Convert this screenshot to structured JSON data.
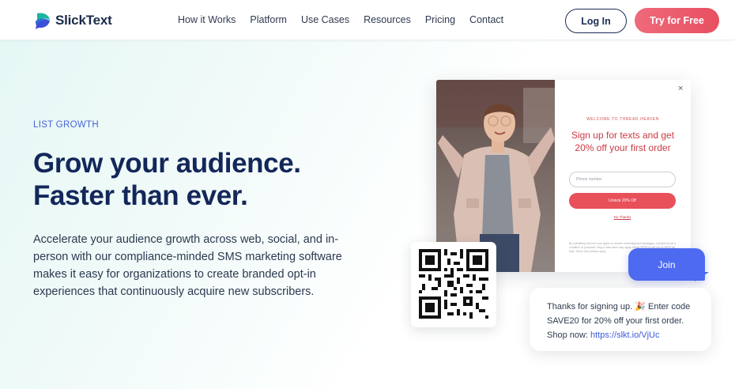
{
  "brand": {
    "name": "SlickText",
    "colors": {
      "navy": "#13275a",
      "accent_blue": "#4a62d8",
      "cta_red": "#e8505f",
      "teal": "#1bb5a0"
    }
  },
  "nav": {
    "items": [
      "How it Works",
      "Platform",
      "Use Cases",
      "Resources",
      "Pricing",
      "Contact"
    ],
    "login_label": "Log In",
    "cta_label": "Try for Free"
  },
  "hero": {
    "eyebrow": "LIST GROWTH",
    "headline_line1": "Grow your audience.",
    "headline_line2": "Faster than ever.",
    "body": "Accelerate your audience growth across web, social, and in-person with our compliance-minded SMS marketing software makes it easy for organizations to create branded opt-in experiences that continuously acquire new subscribers."
  },
  "popup": {
    "close_icon": "×",
    "eyebrow": "WELCOME TO THREAD HEAVEN",
    "title": "Sign up for texts and get 20% off your first order",
    "input_placeholder": "Phone number",
    "button_label": "Unlock 20% Off",
    "decline_label": "No Thanks",
    "fine_print": "By submitting this form you agree to receive marketing text messages. Consent is not a condition of purchase. Msg & data rates may apply. Reply STOP to opt out or HELP for help. Terms and privacy apply."
  },
  "join_bubble": {
    "label": "Join"
  },
  "confirmation_message": {
    "line1": "Thanks for signing up. 🎉 Enter code",
    "line2": "SAVE20 for 20% off your first order.",
    "shop_prefix": "Shop now: ",
    "shop_link": "https://slkt.io/VjUc"
  }
}
